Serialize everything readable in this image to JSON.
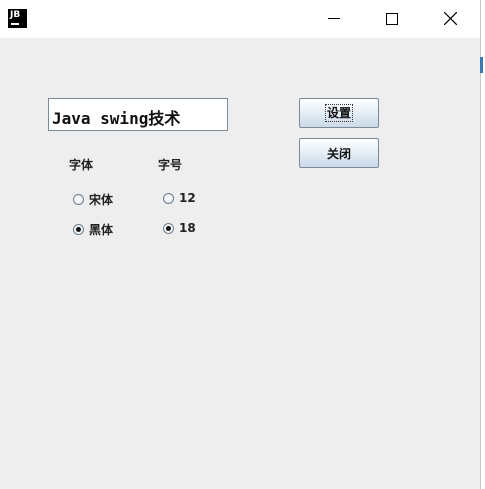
{
  "window": {
    "app_icon_text": "JB",
    "controls": {
      "minimize": "minimize-icon",
      "maximize": "maximize-icon",
      "close": "close-icon"
    }
  },
  "text_field": {
    "value": "Java swing技术"
  },
  "buttons": {
    "set_label": "设置",
    "close_label": "关闭"
  },
  "font_group": {
    "label": "字体",
    "options": [
      {
        "label": "宋体",
        "checked": false
      },
      {
        "label": "黑体",
        "checked": true
      }
    ]
  },
  "size_group": {
    "label": "字号",
    "options": [
      {
        "label": "12",
        "checked": false
      },
      {
        "label": "18",
        "checked": true
      }
    ]
  },
  "colors": {
    "background": "#eeeeee",
    "titlebar": "#ffffff",
    "accent": "#3a78b8"
  }
}
